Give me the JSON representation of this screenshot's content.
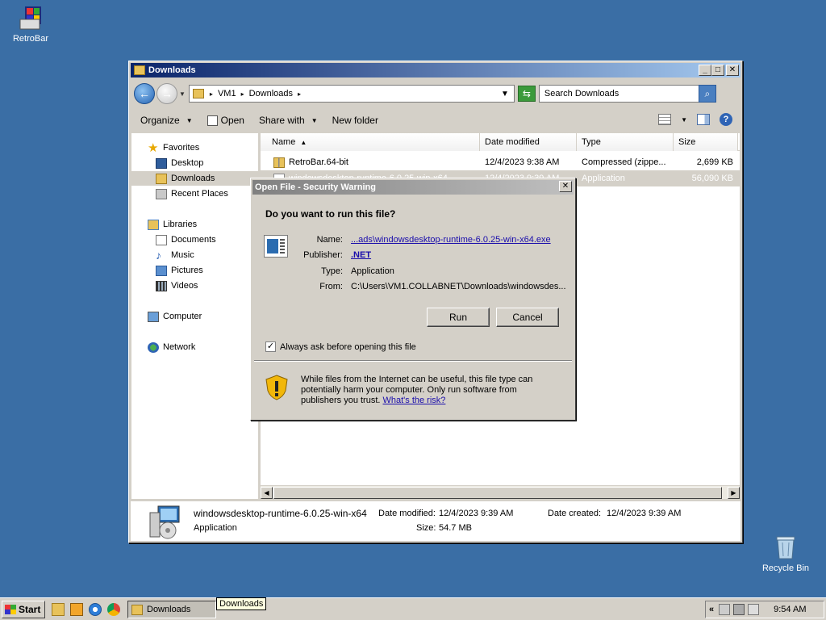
{
  "desktop": {
    "icons": [
      {
        "label": "RetroBar"
      },
      {
        "label": "Recycle Bin"
      }
    ]
  },
  "explorer": {
    "title": "Downloads",
    "address": {
      "crumbs": [
        "VM1",
        "Downloads"
      ]
    },
    "search_placeholder": "Search Downloads",
    "commands": {
      "organize": "Organize",
      "open": "Open",
      "share_with": "Share with",
      "new_folder": "New folder"
    },
    "nav": {
      "favorites": "Favorites",
      "desktop": "Desktop",
      "downloads": "Downloads",
      "recent_places": "Recent Places",
      "libraries": "Libraries",
      "documents": "Documents",
      "music": "Music",
      "pictures": "Pictures",
      "videos": "Videos",
      "computer": "Computer",
      "network": "Network"
    },
    "columns": {
      "name": "Name",
      "date": "Date modified",
      "type": "Type",
      "size": "Size"
    },
    "files": [
      {
        "name": "RetroBar.64-bit",
        "date": "12/4/2023 9:38 AM",
        "type": "Compressed (zippe...",
        "size": "2,699 KB"
      },
      {
        "name": "windowsdesktop-runtime-6.0.25-win-x64",
        "date": "12/4/2023 9:39 AM",
        "type": "Application",
        "size": "56,090 KB"
      }
    ],
    "details": {
      "filename": "windowsdesktop-runtime-6.0.25-win-x64",
      "type": "Application",
      "date_modified_label": "Date modified:",
      "date_modified": "12/4/2023 9:39 AM",
      "date_created_label": "Date created:",
      "date_created": "12/4/2023 9:39 AM",
      "size_label": "Size:",
      "size": "54.7 MB"
    }
  },
  "dialog": {
    "title": "Open File - Security Warning",
    "question": "Do you want to run this file?",
    "name_label": "Name:",
    "name_value": "...ads\\windowsdesktop-runtime-6.0.25-win-x64.exe",
    "publisher_label": "Publisher:",
    "publisher_value": ".NET",
    "type_label": "Type:",
    "type_value": "Application",
    "from_label": "From:",
    "from_value": "C:\\Users\\VM1.COLLABNET\\Downloads\\windowsdes...",
    "run_label": "Run",
    "cancel_label": "Cancel",
    "checkbox_label": "Always ask before opening this file",
    "checkbox_checked": true,
    "warning_text": "While files from the Internet can be useful, this file type can potentially harm your computer. Only run software from publishers you trust.",
    "risk_link": "What's the risk?"
  },
  "taskbar": {
    "start": "Start",
    "task_label": "Downloads",
    "tooltip": "Downloads",
    "clock": "9:54 AM"
  }
}
